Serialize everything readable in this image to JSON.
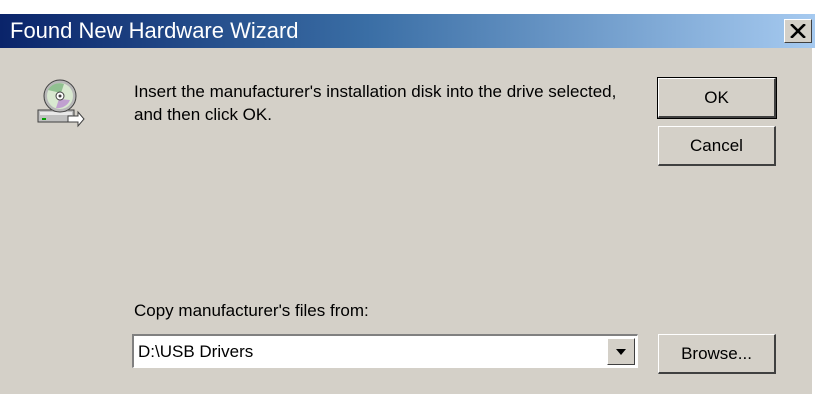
{
  "window": {
    "title": "Found New Hardware Wizard",
    "title_gradient": [
      "#0a246a",
      "#3a6ea5",
      "#a6caf0"
    ],
    "background": "#d4d0c8"
  },
  "icons": {
    "close": "close-icon",
    "disk": "install-disk-icon",
    "dropdown": "chevron-down-icon"
  },
  "message": {
    "text": "Insert the manufacturer's installation disk into the drive selected, and then click OK."
  },
  "buttons": {
    "ok_label": "OK",
    "cancel_label": "Cancel",
    "browse_label": "Browse..."
  },
  "copy_from": {
    "label": "Copy manufacturer's files from:",
    "value": "D:\\USB Drivers"
  }
}
